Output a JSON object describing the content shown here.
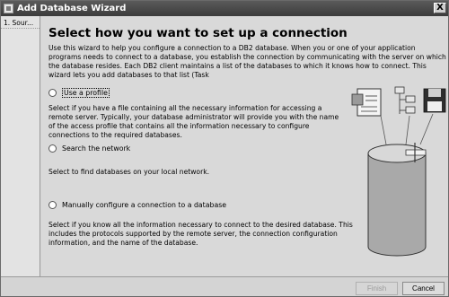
{
  "window": {
    "title": "Add Database Wizard",
    "close_glyph": "X"
  },
  "nav": {
    "items": [
      {
        "label": "1. Sour..."
      }
    ]
  },
  "main": {
    "heading": "Select how you want to set up a connection",
    "intro": "Use this wizard to help you configure a connection to a DB2 database. When you or one of your application programs needs to connect to a database, you establish the connection by communicating with the server on which the database resides. Each DB2 client maintains a list of the databases to which it knows how to connect. This wizard lets you add databases to that list (Task",
    "options": [
      {
        "label": "Use a profile",
        "selected": false,
        "description": "Select if you have a file containing all the necessary information for accessing a remote server. Typically, your database administrator will provide you with the name of the access profile that contains all the information necessary to configure connections to the required databases."
      },
      {
        "label": "Search the network",
        "selected": false,
        "description": "Select to find databases on your local network."
      },
      {
        "label": "Manually configure a connection to a database",
        "selected": false,
        "description": "Select if you know all the information necessary to connect to the desired database. This includes the protocols supported by the remote server, the connection configuration information, and the name of the database."
      }
    ]
  },
  "footer": {
    "finish_label": "Finish",
    "cancel_label": "Cancel",
    "finish_enabled": false
  },
  "colors": {
    "titlebar": "#4a4a4a",
    "content_bg": "#d9d9d9",
    "nav_bg": "#e3e3e3"
  }
}
